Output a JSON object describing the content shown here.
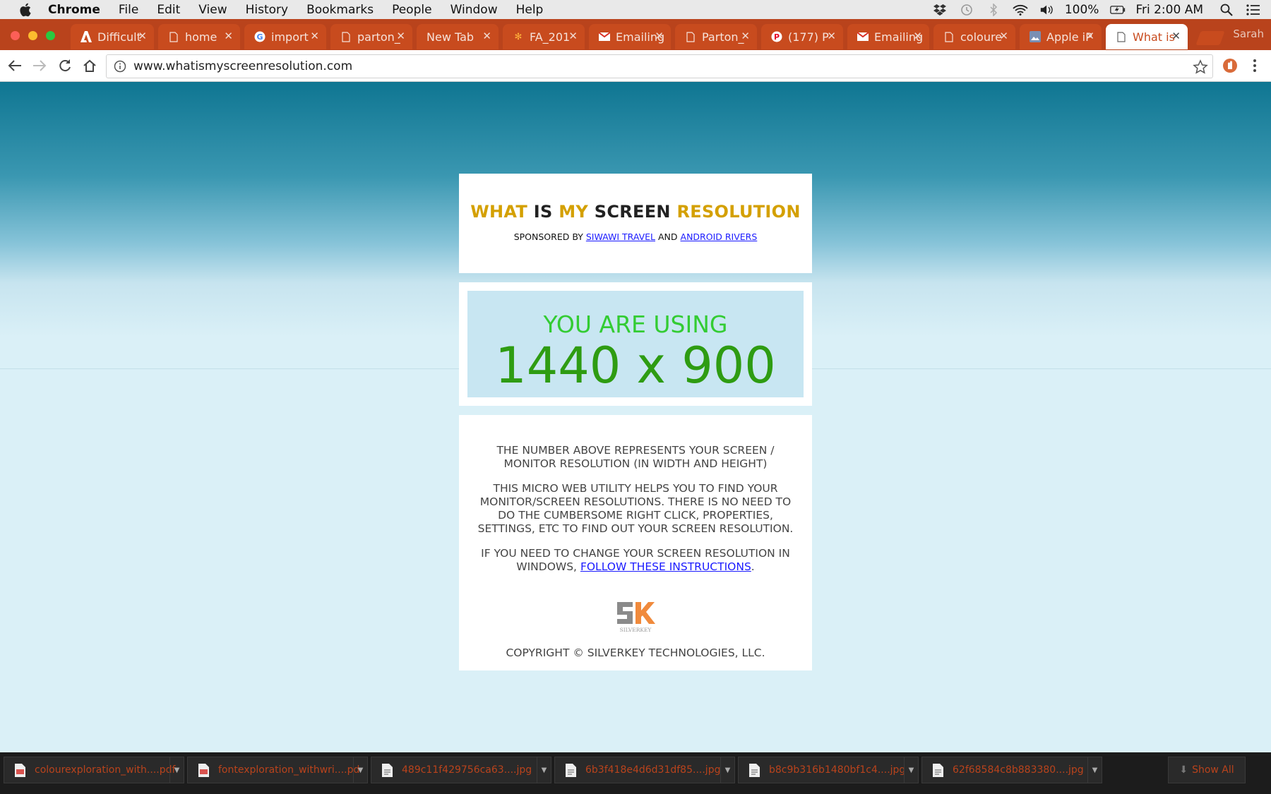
{
  "menubar": {
    "app_name": "Chrome",
    "items": [
      "File",
      "Edit",
      "View",
      "History",
      "Bookmarks",
      "People",
      "Window",
      "Help"
    ],
    "battery": "100%",
    "clock": "Fri 2:00 AM"
  },
  "tabs": [
    {
      "label": "Difficult",
      "icon": "adobe-icon"
    },
    {
      "label": "home",
      "icon": "page-icon"
    },
    {
      "label": "import",
      "icon": "google-icon"
    },
    {
      "label": "parton_",
      "icon": "page-icon"
    },
    {
      "label": "New Tab",
      "icon": ""
    },
    {
      "label": "FA_201",
      "icon": "pinwheel-icon"
    },
    {
      "label": "Emailing",
      "icon": "gmail-icon"
    },
    {
      "label": "Parton_",
      "icon": "page-icon"
    },
    {
      "label": "(177) P",
      "icon": "pinterest-icon"
    },
    {
      "label": "Emailing",
      "icon": "gmail-icon"
    },
    {
      "label": "coloure",
      "icon": "page-icon"
    },
    {
      "label": "Apple iP",
      "icon": "photo-icon"
    },
    {
      "label": "What is",
      "icon": "page-icon",
      "active": true
    }
  ],
  "profile_name": "Sarah",
  "toolbar": {
    "url": "www.whatismyscreenresolution.com"
  },
  "site": {
    "title_parts": [
      "WHAT",
      "IS",
      "MY",
      "SCREEN",
      "RESOLUTION"
    ],
    "sponsor_prefix": "SPONSORED BY",
    "sponsor1": "SIWAWI TRAVEL",
    "sponsor_and": "AND",
    "sponsor2": "ANDROID RIVERS",
    "using_label": "YOU ARE USING",
    "resolution": "1440 x 900",
    "para1": "THE NUMBER ABOVE REPRESENTS YOUR SCREEN / MONITOR RESOLUTION (IN WIDTH AND HEIGHT)",
    "para2": "THIS MICRO WEB UTILITY HELPS YOU TO FIND YOUR MONITOR/SCREEN RESOLUTIONS. THERE IS NO NEED TO DO THE CUMBERSOME RIGHT CLICK, PROPERTIES, SETTINGS, ETC TO FIND OUT YOUR SCREEN RESOLUTION.",
    "para3_prefix": "IF YOU NEED TO CHANGE YOUR SCREEN RESOLUTION IN WINDOWS,",
    "para3_link": "FOLLOW THESE INSTRUCTIONS",
    "para3_suffix": ".",
    "logo_text": "SILVERKEY",
    "copyright": "COPYRIGHT © SILVERKEY TECHNOLOGIES, LLC."
  },
  "downloads": [
    {
      "name": "colourexploration_with....pdf",
      "type": "pdf"
    },
    {
      "name": "fontexploration_withwri....pdf",
      "type": "pdf"
    },
    {
      "name": "489c11f429756ca63....jpg",
      "type": "jpg"
    },
    {
      "name": "6b3f418e4d6d31df85....jpg",
      "type": "jpg"
    },
    {
      "name": "b8c9b316b1480bf1c4....jpg",
      "type": "jpg"
    },
    {
      "name": "62f68584c8b883380....jpg",
      "type": "jpg"
    }
  ],
  "show_all": "Show All",
  "colors": {
    "tabstrip": "#b9431c",
    "gold": "#d4a000",
    "green_light": "#33cc33",
    "green_dark": "#2e9c12",
    "link": "#1a1aff"
  }
}
